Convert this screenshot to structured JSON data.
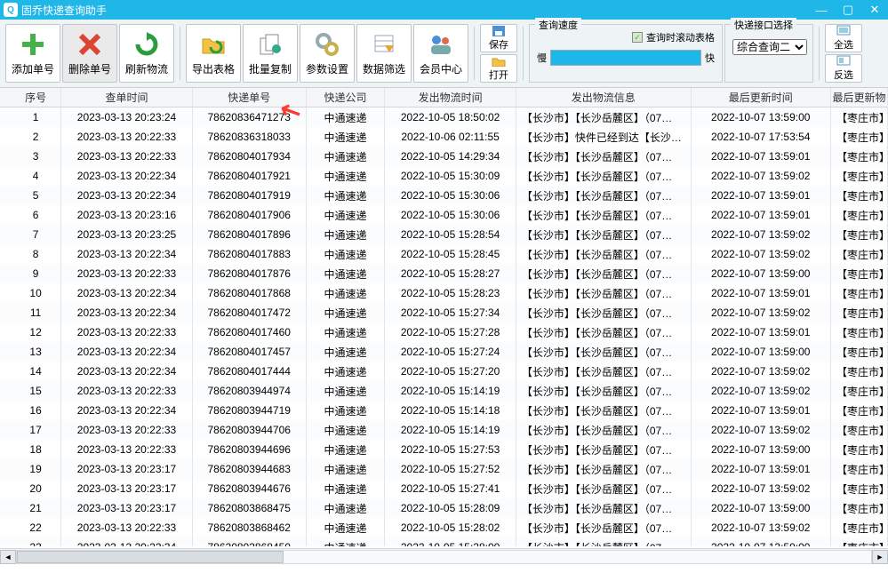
{
  "window": {
    "title": "固乔快递查询助手"
  },
  "toolbar": {
    "add": "添加单号",
    "del": "删除单号",
    "refresh": "刷新物流",
    "export": "导出表格",
    "copy": "批量复制",
    "settings": "参数设置",
    "filter": "数据筛选",
    "member": "会员中心",
    "save": "保存",
    "open": "打开",
    "selall": "全选",
    "invsel": "反选"
  },
  "speed": {
    "legend": "查询速度",
    "scroll_label": "查询时滚动表格",
    "slow": "慢",
    "fast": "快"
  },
  "iface": {
    "legend": "快递接口选择",
    "selected": "综合查询二"
  },
  "columns": [
    "序号",
    "查单时间",
    "快递单号",
    "快递公司",
    "发出物流时间",
    "发出物流信息",
    "最后更新时间",
    "最后更新物"
  ],
  "rows": [
    {
      "n": "1",
      "t": "2023-03-13 20:23:24",
      "no": "78620836471273",
      "co": "中通速递",
      "st": "2022-10-05 18:50:02",
      "info": "【长沙市】【长沙岳麓区】（07…",
      "ut": "2022-10-07 13:59:00",
      "last": "【枣庄市】忄"
    },
    {
      "n": "2",
      "t": "2023-03-13 20:22:33",
      "no": "78620836318033",
      "co": "中通速递",
      "st": "2022-10-06 02:11:55",
      "info": "【长沙市】快件已经到达【长沙…",
      "ut": "2022-10-07 17:53:54",
      "last": "【枣庄市】忄"
    },
    {
      "n": "3",
      "t": "2023-03-13 20:22:33",
      "no": "78620804017934",
      "co": "中通速递",
      "st": "2022-10-05 14:29:34",
      "info": "【长沙市】【长沙岳麓区】（07…",
      "ut": "2022-10-07 13:59:01",
      "last": "【枣庄市】忄"
    },
    {
      "n": "4",
      "t": "2023-03-13 20:22:34",
      "no": "78620804017921",
      "co": "中通速递",
      "st": "2022-10-05 15:30:09",
      "info": "【长沙市】【长沙岳麓区】（07…",
      "ut": "2022-10-07 13:59:02",
      "last": "【枣庄市】忄"
    },
    {
      "n": "5",
      "t": "2023-03-13 20:22:34",
      "no": "78620804017919",
      "co": "中通速递",
      "st": "2022-10-05 15:30:06",
      "info": "【长沙市】【长沙岳麓区】（07…",
      "ut": "2022-10-07 13:59:01",
      "last": "【枣庄市】忄"
    },
    {
      "n": "6",
      "t": "2023-03-13 20:23:16",
      "no": "78620804017906",
      "co": "中通速递",
      "st": "2022-10-05 15:30:06",
      "info": "【长沙市】【长沙岳麓区】（07…",
      "ut": "2022-10-07 13:59:01",
      "last": "【枣庄市】忄"
    },
    {
      "n": "7",
      "t": "2023-03-13 20:23:25",
      "no": "78620804017896",
      "co": "中通速递",
      "st": "2022-10-05 15:28:54",
      "info": "【长沙市】【长沙岳麓区】（07…",
      "ut": "2022-10-07 13:59:02",
      "last": "【枣庄市】忄"
    },
    {
      "n": "8",
      "t": "2023-03-13 20:22:34",
      "no": "78620804017883",
      "co": "中通速递",
      "st": "2022-10-05 15:28:45",
      "info": "【长沙市】【长沙岳麓区】（07…",
      "ut": "2022-10-07 13:59:02",
      "last": "【枣庄市】忄"
    },
    {
      "n": "9",
      "t": "2023-03-13 20:22:33",
      "no": "78620804017876",
      "co": "中通速递",
      "st": "2022-10-05 15:28:27",
      "info": "【长沙市】【长沙岳麓区】（07…",
      "ut": "2022-10-07 13:59:00",
      "last": "【枣庄市】忄"
    },
    {
      "n": "10",
      "t": "2023-03-13 20:22:34",
      "no": "78620804017868",
      "co": "中通速递",
      "st": "2022-10-05 15:28:23",
      "info": "【长沙市】【长沙岳麓区】（07…",
      "ut": "2022-10-07 13:59:01",
      "last": "【枣庄市】忄"
    },
    {
      "n": "11",
      "t": "2023-03-13 20:22:34",
      "no": "78620804017472",
      "co": "中通速递",
      "st": "2022-10-05 15:27:34",
      "info": "【长沙市】【长沙岳麓区】（07…",
      "ut": "2022-10-07 13:59:02",
      "last": "【枣庄市】忄"
    },
    {
      "n": "12",
      "t": "2023-03-13 20:22:33",
      "no": "78620804017460",
      "co": "中通速递",
      "st": "2022-10-05 15:27:28",
      "info": "【长沙市】【长沙岳麓区】（07…",
      "ut": "2022-10-07 13:59:01",
      "last": "【枣庄市】忄"
    },
    {
      "n": "13",
      "t": "2023-03-13 20:22:34",
      "no": "78620804017457",
      "co": "中通速递",
      "st": "2022-10-05 15:27:24",
      "info": "【长沙市】【长沙岳麓区】（07…",
      "ut": "2022-10-07 13:59:00",
      "last": "【枣庄市】忄"
    },
    {
      "n": "14",
      "t": "2023-03-13 20:22:34",
      "no": "78620804017444",
      "co": "中通速递",
      "st": "2022-10-05 15:27:20",
      "info": "【长沙市】【长沙岳麓区】（07…",
      "ut": "2022-10-07 13:59:02",
      "last": "【枣庄市】忄"
    },
    {
      "n": "15",
      "t": "2023-03-13 20:22:33",
      "no": "78620803944974",
      "co": "中通速递",
      "st": "2022-10-05 15:14:19",
      "info": "【长沙市】【长沙岳麓区】（07…",
      "ut": "2022-10-07 13:59:02",
      "last": "【枣庄市】忄"
    },
    {
      "n": "16",
      "t": "2023-03-13 20:22:34",
      "no": "78620803944719",
      "co": "中通速递",
      "st": "2022-10-05 15:14:18",
      "info": "【长沙市】【长沙岳麓区】（07…",
      "ut": "2022-10-07 13:59:01",
      "last": "【枣庄市】忄"
    },
    {
      "n": "17",
      "t": "2023-03-13 20:22:33",
      "no": "78620803944706",
      "co": "中通速递",
      "st": "2022-10-05 15:14:19",
      "info": "【长沙市】【长沙岳麓区】（07…",
      "ut": "2022-10-07 13:59:02",
      "last": "【枣庄市】忄"
    },
    {
      "n": "18",
      "t": "2023-03-13 20:22:33",
      "no": "78620803944696",
      "co": "中通速递",
      "st": "2022-10-05 15:27:53",
      "info": "【长沙市】【长沙岳麓区】（07…",
      "ut": "2022-10-07 13:59:00",
      "last": "【枣庄市】忄"
    },
    {
      "n": "19",
      "t": "2023-03-13 20:23:17",
      "no": "78620803944683",
      "co": "中通速递",
      "st": "2022-10-05 15:27:52",
      "info": "【长沙市】【长沙岳麓区】（07…",
      "ut": "2022-10-07 13:59:01",
      "last": "【枣庄市】忄"
    },
    {
      "n": "20",
      "t": "2023-03-13 20:23:17",
      "no": "78620803944676",
      "co": "中通速递",
      "st": "2022-10-05 15:27:41",
      "info": "【长沙市】【长沙岳麓区】（07…",
      "ut": "2022-10-07 13:59:02",
      "last": "【枣庄市】忄"
    },
    {
      "n": "21",
      "t": "2023-03-13 20:23:17",
      "no": "78620803868475",
      "co": "中通速递",
      "st": "2022-10-05 15:28:09",
      "info": "【长沙市】【长沙岳麓区】（07…",
      "ut": "2022-10-07 13:59:00",
      "last": "【枣庄市】忄"
    },
    {
      "n": "22",
      "t": "2023-03-13 20:22:33",
      "no": "78620803868462",
      "co": "中通速递",
      "st": "2022-10-05 15:28:02",
      "info": "【长沙市】【长沙岳麓区】（07…",
      "ut": "2022-10-07 13:59:02",
      "last": "【枣庄市】忄"
    },
    {
      "n": "23",
      "t": "2023-03-13 20:22:34",
      "no": "78620803868450",
      "co": "中通速递",
      "st": "2022-10-05 15:28:00",
      "info": "【长沙市】【长沙岳麓区】（07…",
      "ut": "2022-10-07 13:59:00",
      "last": "【枣庄市】忄"
    }
  ]
}
